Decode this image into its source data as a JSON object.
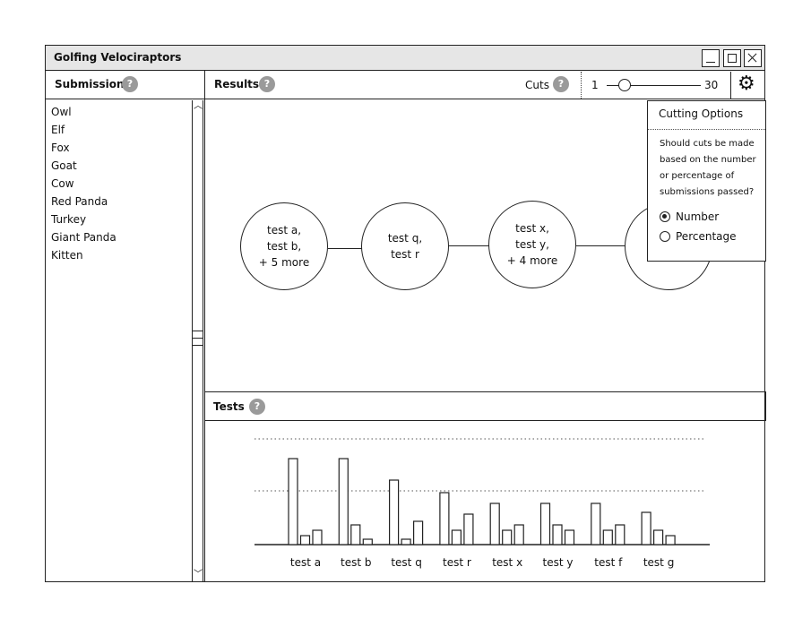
{
  "window": {
    "title": "Golfing Velociraptors"
  },
  "submissions": {
    "header": "Submissions",
    "items": [
      "Owl",
      "Elf",
      "Fox",
      "Goat",
      "Cow",
      "Red Panda",
      "Turkey",
      "Giant Panda",
      "Kitten"
    ]
  },
  "results": {
    "header": "Results",
    "cuts_label": "Cuts",
    "slider": {
      "min": "1",
      "max": "30",
      "value": 1
    },
    "nodes": [
      {
        "lines": [
          "test a,",
          "test b,",
          "+ 5 more"
        ]
      },
      {
        "lines": [
          "test q,",
          "test r"
        ]
      },
      {
        "lines": [
          "test x,",
          "test y,",
          "+ 4 more"
        ]
      }
    ]
  },
  "cutting_options": {
    "title": "Cutting Options",
    "question": "Should cuts be made based on the number or percentage of submissions passed?",
    "options": [
      {
        "label": "Number",
        "selected": true
      },
      {
        "label": "Percentage",
        "selected": false
      }
    ]
  },
  "tests": {
    "header": "Tests"
  },
  "chart_data": {
    "type": "bar",
    "categories": [
      "test a",
      "test b",
      "test q",
      "test r",
      "test x",
      "test y",
      "test f",
      "test g"
    ],
    "series": [
      {
        "values": [
          96,
          96,
          72,
          58,
          46,
          46,
          46,
          36
        ]
      },
      {
        "values": [
          10,
          22,
          6,
          16,
          16,
          22,
          16,
          16
        ]
      },
      {
        "values": [
          16,
          6,
          26,
          34,
          22,
          16,
          22,
          10
        ]
      }
    ],
    "reference_lines": [
      118,
      60
    ],
    "grid": false
  },
  "icons": {
    "help": "?",
    "gear": "⚙"
  }
}
